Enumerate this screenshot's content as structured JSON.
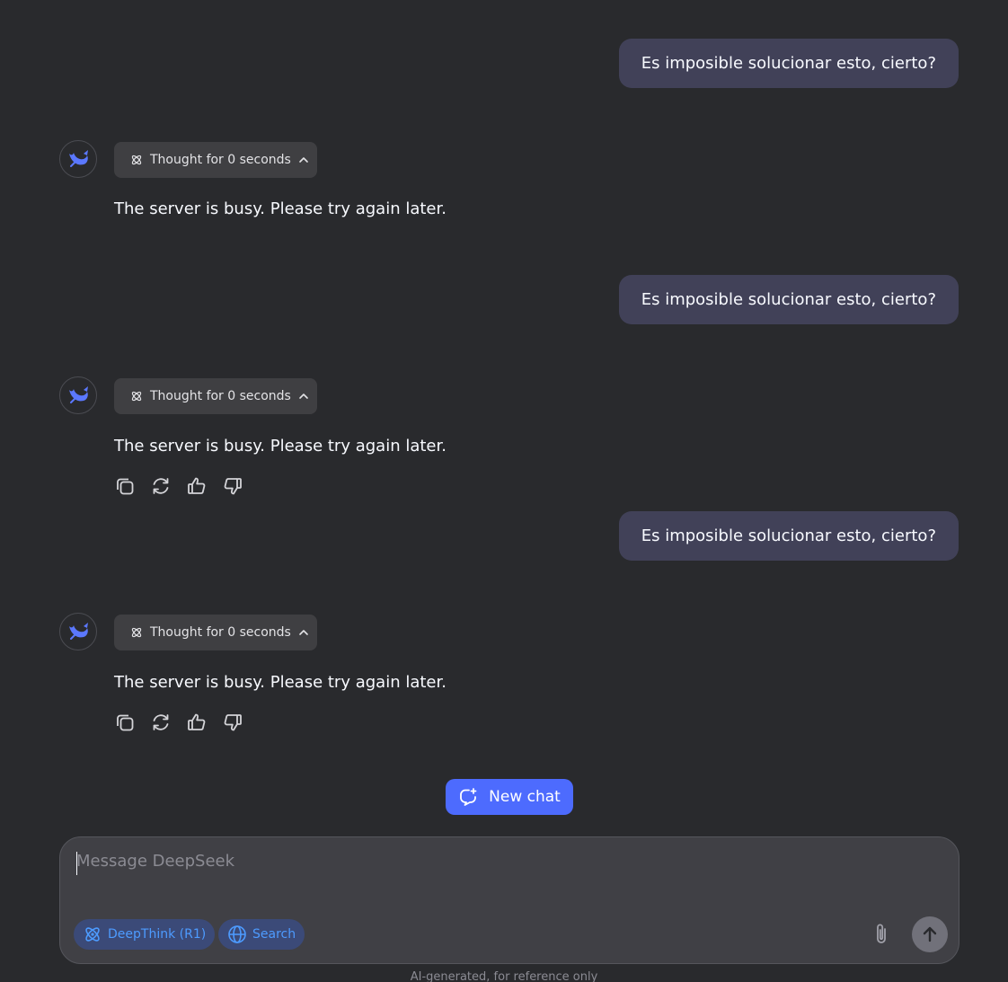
{
  "conversation": {
    "messages": [
      {
        "role": "user",
        "text": "Es imposible solucionar esto, cierto?"
      },
      {
        "role": "assistant",
        "thought_label": "Thought for 0 seconds",
        "text": "The server is busy. Please try again later.",
        "show_actions": false
      },
      {
        "role": "user",
        "text": "Es imposible solucionar esto, cierto?"
      },
      {
        "role": "assistant",
        "thought_label": "Thought for 0 seconds",
        "text": "The server is busy. Please try again later.",
        "show_actions": true
      },
      {
        "role": "user",
        "text": "Es imposible solucionar esto, cierto?"
      },
      {
        "role": "assistant",
        "thought_label": "Thought for 0 seconds",
        "text": "The server is busy. Please try again later.",
        "show_actions": true
      }
    ],
    "action_icons": [
      "copy-icon",
      "regenerate-icon",
      "thumbs-up-icon",
      "thumbs-down-icon"
    ]
  },
  "new_chat": {
    "label": "New chat",
    "icon": "new-chat-icon"
  },
  "composer": {
    "placeholder": "Message DeepSeek",
    "value": "",
    "deepthink_label": "DeepThink (R1)",
    "search_label": "Search",
    "attach_icon": "paperclip-icon",
    "send_icon": "arrow-up-icon"
  },
  "footer": {
    "note": "AI-generated, for reference only"
  },
  "colors": {
    "background": "#292a2d",
    "user_bubble": "#414158",
    "accent": "#4d6bfe",
    "pill_text": "#4d9bff"
  }
}
